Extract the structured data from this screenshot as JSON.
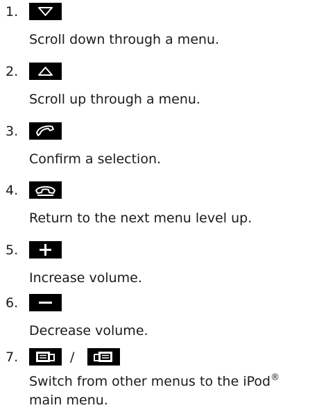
{
  "steps": [
    {
      "number": "1.",
      "icon": "scroll-down-arrow-icon",
      "description": "Scroll down through a menu."
    },
    {
      "number": "2.",
      "icon": "scroll-up-arrow-icon",
      "description": "Scroll up through a menu."
    },
    {
      "number": "3.",
      "icon": "phone-pickup-icon",
      "description": "Confirm a selection."
    },
    {
      "number": "4.",
      "icon": "phone-hangup-icon",
      "description": "Return to the next menu level up."
    },
    {
      "number": "5.",
      "icon": "plus-icon",
      "description": "Increase volume."
    },
    {
      "number": "6.",
      "icon": "minus-icon",
      "description": "Decrease volume."
    },
    {
      "number": "7.",
      "icon": "menu-page-left-icon / menu-page-right-icon",
      "separator": "/",
      "description_before": "Switch from other menus to the iPod",
      "superscript": "®",
      "description_after": "main menu."
    }
  ]
}
